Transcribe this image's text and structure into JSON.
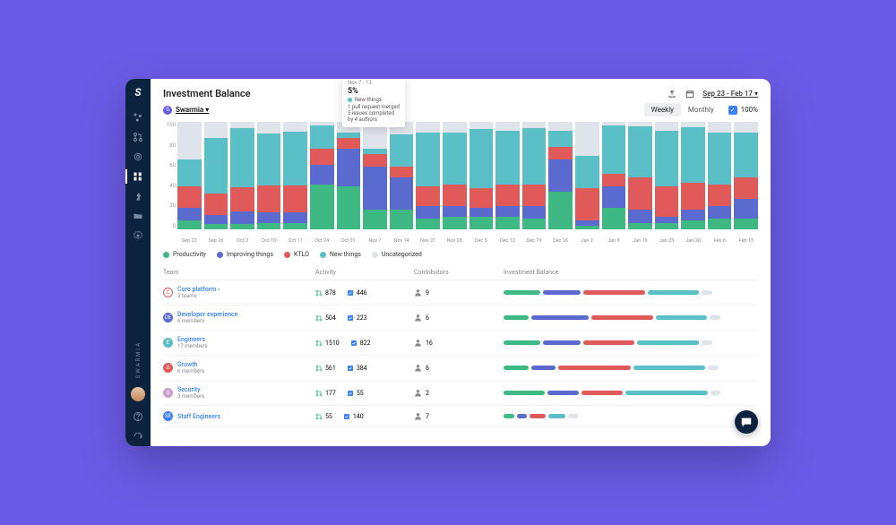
{
  "page": {
    "title": "Investment Balance"
  },
  "breadcrumb": {
    "badge": "S",
    "label": "Swarmia"
  },
  "header": {
    "date_range": "Sep 23 - Feb 17",
    "toggle": {
      "weekly": "Weekly",
      "monthly": "Monthly",
      "active": "weekly"
    },
    "pct_label": "100%"
  },
  "sidebar": {
    "brand_vertical": "SWARMIA"
  },
  "legend": [
    {
      "label": "Productivity",
      "color": "#3fb984"
    },
    {
      "label": "Improving things",
      "color": "#5a6acf"
    },
    {
      "label": "KTLO",
      "color": "#e05a5a"
    },
    {
      "label": "New things",
      "color": "#5abfc7"
    },
    {
      "label": "Uncategorized",
      "color": "#dfe3ea"
    }
  ],
  "tooltip": {
    "date": "Nov 7 - 13",
    "pct": "5%",
    "category": "New things",
    "lines": [
      "1 pull request merged",
      "5 issues completed",
      "by 4 authors"
    ]
  },
  "chart_data": {
    "type": "bar",
    "ylabel": "%",
    "ylim": [
      0,
      100
    ],
    "yticks": [
      100,
      80,
      60,
      40,
      20,
      0
    ],
    "stack_order": [
      "Productivity",
      "Improving things",
      "KTLO",
      "New things",
      "Uncategorized"
    ],
    "colors": {
      "Productivity": "#3fb984",
      "Improving things": "#5a6acf",
      "KTLO": "#e05a5a",
      "New things": "#5abfc7",
      "Uncategorized": "#dfe3ea"
    },
    "categories": [
      "Sep 23",
      "Sep 26",
      "Oct 3",
      "Oct 10",
      "Oct 17",
      "Oct 24",
      "Oct 31",
      "Nov 7",
      "Nov 14",
      "Nov 21",
      "Nov 28",
      "Dec 5",
      "Dec 12",
      "Dec 19",
      "Dec 26",
      "Jan 2",
      "Jan 9",
      "Jan 16",
      "Jan 23",
      "Jan 30",
      "Feb 6",
      "Feb 13"
    ],
    "series": [
      {
        "name": "Productivity",
        "values": [
          8,
          5,
          5,
          6,
          6,
          42,
          40,
          18,
          18,
          10,
          12,
          12,
          12,
          10,
          35,
          3,
          20,
          6,
          6,
          8,
          10,
          10
        ]
      },
      {
        "name": "Improving things",
        "values": [
          12,
          8,
          12,
          10,
          10,
          18,
          35,
          40,
          30,
          12,
          10,
          8,
          10,
          12,
          30,
          5,
          20,
          12,
          6,
          10,
          12,
          18
        ]
      },
      {
        "name": "KTLO",
        "values": [
          20,
          20,
          22,
          25,
          25,
          15,
          10,
          12,
          10,
          18,
          20,
          18,
          20,
          20,
          12,
          30,
          12,
          30,
          28,
          25,
          20,
          20
        ]
      },
      {
        "name": "New things",
        "values": [
          25,
          52,
          55,
          48,
          50,
          22,
          5,
          5,
          30,
          50,
          48,
          55,
          50,
          52,
          15,
          30,
          45,
          48,
          52,
          52,
          48,
          42
        ]
      },
      {
        "name": "Uncategorized",
        "values": [
          35,
          15,
          6,
          11,
          9,
          3,
          10,
          25,
          12,
          10,
          10,
          7,
          8,
          6,
          8,
          32,
          3,
          4,
          8,
          5,
          10,
          10
        ]
      }
    ]
  },
  "table": {
    "headers": {
      "team": "Team",
      "activity": "Activity",
      "contributors": "Contributors",
      "balance": "Investment Balance"
    },
    "rows": [
      {
        "badge_color": "#e05a5a",
        "badge_outline": true,
        "badge_letter": "С",
        "name": "Core platform",
        "caret": true,
        "sub": "3 teams",
        "prs": "878",
        "issues": "446",
        "contrib": "9",
        "balance": [
          18,
          18,
          30,
          25,
          5
        ]
      },
      {
        "badge_color": "#5a6acf",
        "badge_letter": "DE",
        "name": "Developer experience",
        "sub": "6 members",
        "prs": "504",
        "issues": "223",
        "contrib": "6",
        "balance": [
          12,
          28,
          30,
          25,
          5
        ]
      },
      {
        "badge_color": "#5abfc7",
        "badge_letter": "E",
        "name": "Engineers",
        "sub": "17 members",
        "prs": "1510",
        "issues": "822",
        "contrib": "16",
        "balance": [
          18,
          18,
          25,
          30,
          5
        ]
      },
      {
        "badge_color": "#e05a5a",
        "badge_letter": "G",
        "name": "Growth",
        "sub": "6 members",
        "prs": "561",
        "issues": "384",
        "contrib": "6",
        "balance": [
          12,
          12,
          35,
          35,
          5
        ]
      },
      {
        "badge_color": "#c9a0c9",
        "badge_letter": "S",
        "name": "Security",
        "sub": "3 members",
        "prs": "177",
        "issues": "55",
        "contrib": "2",
        "balance": [
          20,
          15,
          20,
          40,
          5
        ]
      },
      {
        "badge_color": "#3b82f6",
        "badge_letter": "SE",
        "name": "Staff Engineers",
        "sub": "",
        "prs": "55",
        "issues": "140",
        "contrib": "7",
        "balance": [
          5,
          5,
          8,
          8,
          5
        ]
      }
    ]
  }
}
